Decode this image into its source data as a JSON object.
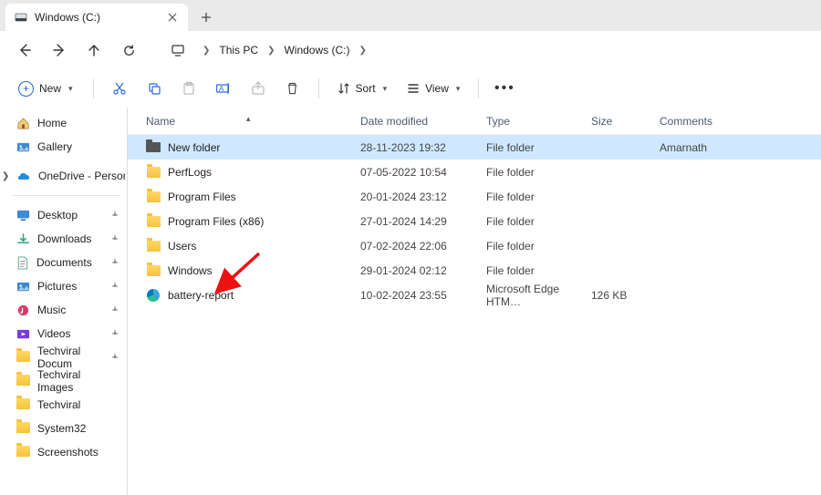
{
  "tab": {
    "title": "Windows (C:)"
  },
  "breadcrumbs": [
    "This PC",
    "Windows (C:)"
  ],
  "toolbar": {
    "new_label": "New",
    "sort_label": "Sort",
    "view_label": "View"
  },
  "sidebar": {
    "home": "Home",
    "gallery": "Gallery",
    "onedrive": "OneDrive - Persona",
    "pins": [
      {
        "icon": "desktop",
        "label": "Desktop"
      },
      {
        "icon": "downloads",
        "label": "Downloads"
      },
      {
        "icon": "documents",
        "label": "Documents"
      },
      {
        "icon": "pictures",
        "label": "Pictures"
      },
      {
        "icon": "music",
        "label": "Music"
      },
      {
        "icon": "videos",
        "label": "Videos"
      },
      {
        "icon": "folder",
        "label": "Techviral Docum"
      },
      {
        "icon": "folder",
        "label": "Techviral Images"
      },
      {
        "icon": "folder",
        "label": "Techviral"
      },
      {
        "icon": "folder",
        "label": "System32"
      },
      {
        "icon": "folder",
        "label": "Screenshots"
      }
    ]
  },
  "columns": {
    "name": "Name",
    "date": "Date modified",
    "type": "Type",
    "size": "Size",
    "comments": "Comments"
  },
  "rows": [
    {
      "icon": "newfolder",
      "name": "New folder",
      "date": "28-11-2023 19:32",
      "type": "File folder",
      "size": "",
      "comments": "Amarnath",
      "selected": true
    },
    {
      "icon": "folder",
      "name": "PerfLogs",
      "date": "07-05-2022 10:54",
      "type": "File folder",
      "size": "",
      "comments": ""
    },
    {
      "icon": "folder",
      "name": "Program Files",
      "date": "20-01-2024 23:12",
      "type": "File folder",
      "size": "",
      "comments": ""
    },
    {
      "icon": "folder",
      "name": "Program Files (x86)",
      "date": "27-01-2024 14:29",
      "type": "File folder",
      "size": "",
      "comments": ""
    },
    {
      "icon": "folder",
      "name": "Users",
      "date": "07-02-2024 22:06",
      "type": "File folder",
      "size": "",
      "comments": ""
    },
    {
      "icon": "folder",
      "name": "Windows",
      "date": "29-01-2024 02:12",
      "type": "File folder",
      "size": "",
      "comments": ""
    },
    {
      "icon": "edge",
      "name": "battery-report",
      "date": "10-02-2024 23:55",
      "type": "Microsoft Edge HTM…",
      "size": "126 KB",
      "comments": ""
    }
  ]
}
